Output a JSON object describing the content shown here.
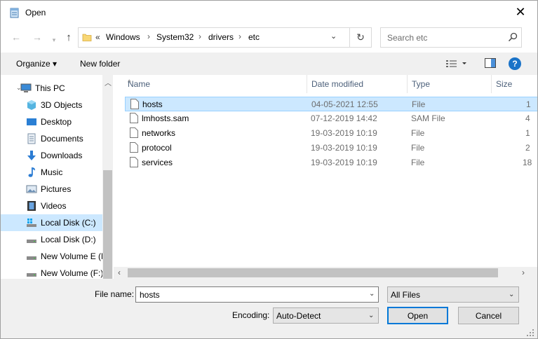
{
  "window": {
    "title": "Open",
    "close_glyph": "✕"
  },
  "nav": {
    "back_glyph": "←",
    "forward_glyph": "→",
    "up_glyph": "↑",
    "address": {
      "overflow_glyph": "«",
      "crumbs": [
        "Windows",
        "System32",
        "drivers",
        "etc"
      ],
      "separator": "›"
    },
    "refresh_glyph": "↻",
    "search_placeholder": "Search etc"
  },
  "toolbar": {
    "organize_label": "Organize ▾",
    "new_folder_label": "New folder",
    "help_glyph": "?"
  },
  "sidebar": {
    "items": [
      {
        "label": "This PC",
        "icon": "this-pc-icon"
      },
      {
        "label": "3D Objects",
        "icon": "3d-objects-icon"
      },
      {
        "label": "Desktop",
        "icon": "desktop-icon"
      },
      {
        "label": "Documents",
        "icon": "documents-icon"
      },
      {
        "label": "Downloads",
        "icon": "downloads-icon"
      },
      {
        "label": "Music",
        "icon": "music-icon"
      },
      {
        "label": "Pictures",
        "icon": "pictures-icon"
      },
      {
        "label": "Videos",
        "icon": "videos-icon"
      },
      {
        "label": "Local Disk (C:)",
        "icon": "drive-icon",
        "selected": true
      },
      {
        "label": "Local Disk (D:)",
        "icon": "drive-icon"
      },
      {
        "label": "New Volume E (E",
        "icon": "drive-icon"
      },
      {
        "label": "New Volume (F:)",
        "icon": "drive-icon"
      }
    ]
  },
  "filelist": {
    "columns": [
      "Name",
      "Date modified",
      "Type",
      "Size"
    ],
    "rows": [
      {
        "name": "hosts",
        "date": "04-05-2021 12:55",
        "type": "File",
        "size": "1",
        "selected": true
      },
      {
        "name": "lmhosts.sam",
        "date": "07-12-2019 14:42",
        "type": "SAM File",
        "size": "4"
      },
      {
        "name": "networks",
        "date": "19-03-2019 10:19",
        "type": "File",
        "size": "1"
      },
      {
        "name": "protocol",
        "date": "19-03-2019 10:19",
        "type": "File",
        "size": "2"
      },
      {
        "name": "services",
        "date": "19-03-2019 10:19",
        "type": "File",
        "size": "18"
      }
    ]
  },
  "footer": {
    "file_name_label": "File name:",
    "file_name_value": "hosts",
    "file_type_value": "All Files",
    "encoding_label": "Encoding:",
    "encoding_value": "Auto-Detect",
    "open_label": "Open",
    "cancel_label": "Cancel"
  },
  "colors": {
    "selection": "#cce8ff",
    "accent": "#0078d7",
    "toolbar_bg": "#f0f0f0"
  }
}
